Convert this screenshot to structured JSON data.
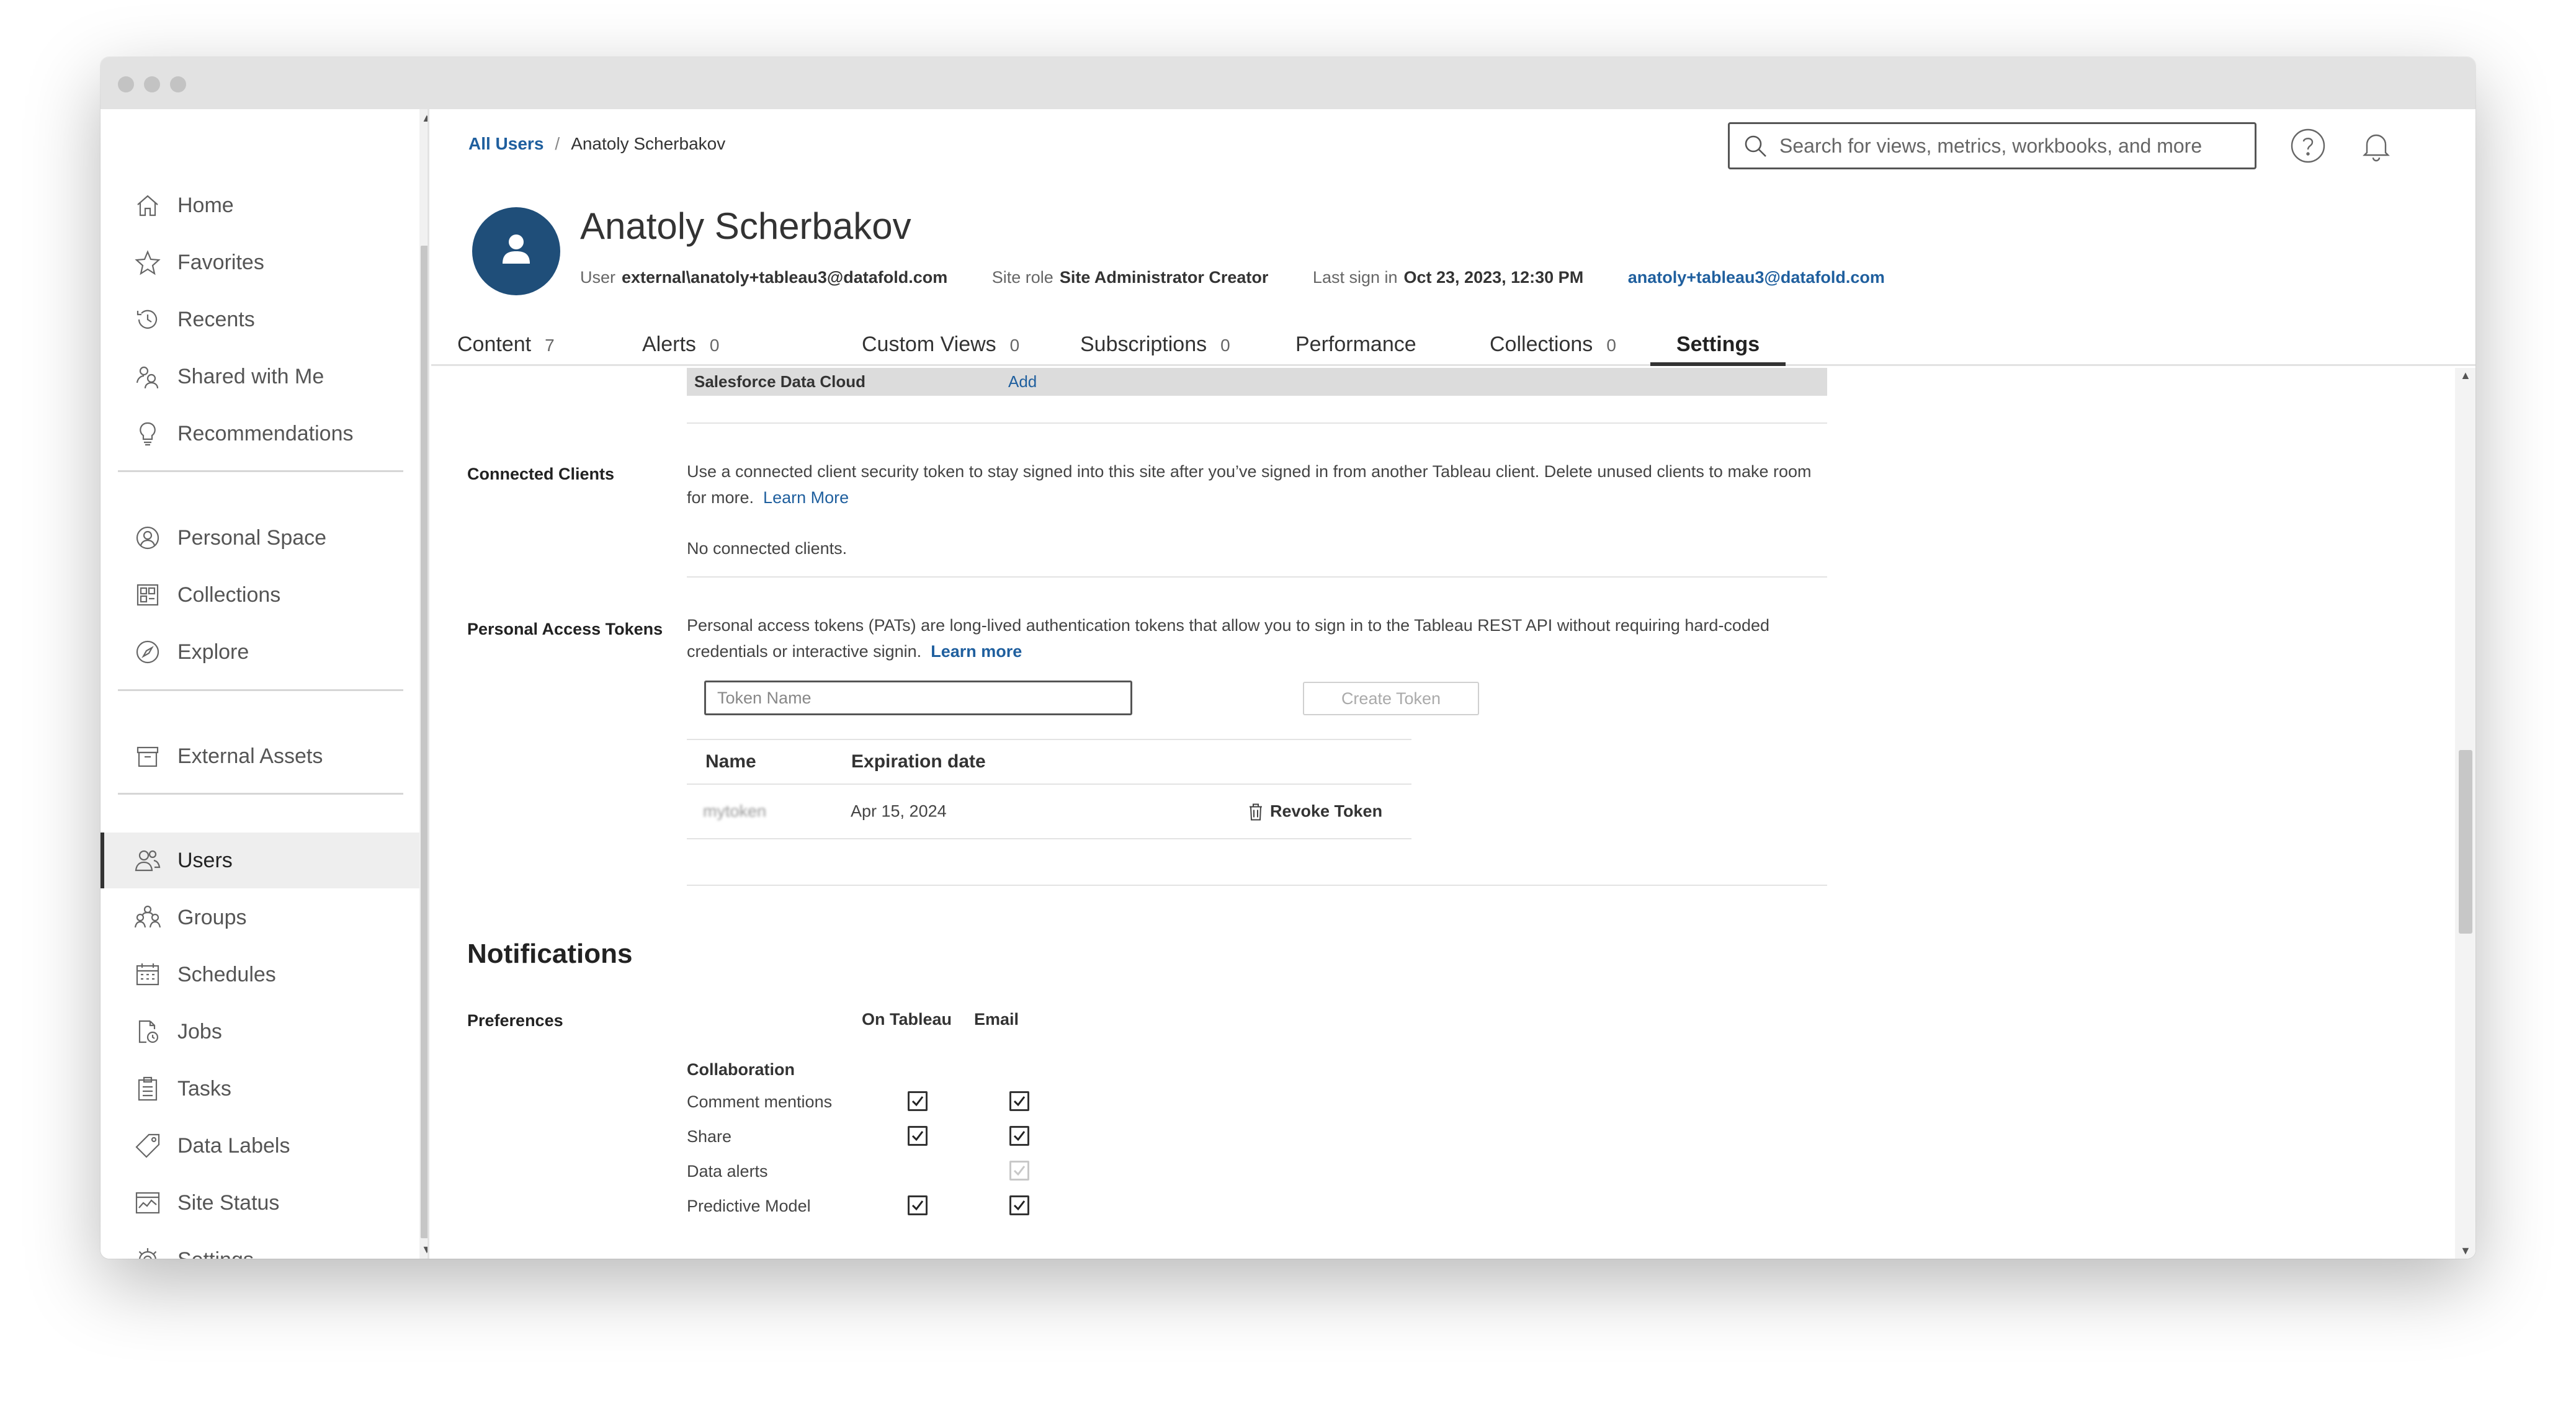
{
  "sidebar": {
    "items": [
      {
        "label": "Home",
        "icon": "home-icon"
      },
      {
        "label": "Favorites",
        "icon": "star-icon"
      },
      {
        "label": "Recents",
        "icon": "history-icon"
      },
      {
        "label": "Shared with Me",
        "icon": "shared-users-icon"
      },
      {
        "label": "Recommendations",
        "icon": "lightbulb-icon"
      },
      {
        "label": "Personal Space",
        "icon": "person-circle-icon"
      },
      {
        "label": "Collections",
        "icon": "collections-icon"
      },
      {
        "label": "Explore",
        "icon": "compass-icon"
      },
      {
        "label": "External Assets",
        "icon": "archive-icon"
      },
      {
        "label": "Users",
        "icon": "users-icon"
      },
      {
        "label": "Groups",
        "icon": "groups-icon"
      },
      {
        "label": "Schedules",
        "icon": "calendar-icon"
      },
      {
        "label": "Jobs",
        "icon": "job-icon"
      },
      {
        "label": "Tasks",
        "icon": "clipboard-icon"
      },
      {
        "label": "Data Labels",
        "icon": "tag-icon"
      },
      {
        "label": "Site Status",
        "icon": "site-status-icon"
      },
      {
        "label": "Settings",
        "icon": "gear-icon"
      }
    ],
    "active": "Users"
  },
  "header": {
    "breadcrumb_root": "All Users",
    "breadcrumb_sep": "/",
    "breadcrumb_current": "Anatoly Scherbakov",
    "search_placeholder": "Search for views, metrics, workbooks, and more"
  },
  "profile": {
    "name": "Anatoly Scherbakov",
    "user_label": "User",
    "user_value": "external\\anatoly+tableau3@datafold.com",
    "site_role_label": "Site role",
    "site_role_value": "Site Administrator Creator",
    "last_sign_in_label": "Last sign in",
    "last_sign_in_value": "Oct 23, 2023, 12:30 PM",
    "email": "anatoly+tableau3@datafold.com"
  },
  "tabs": [
    {
      "label": "Content",
      "count": "7"
    },
    {
      "label": "Alerts",
      "count": "0"
    },
    {
      "label": "Custom Views",
      "count": "0"
    },
    {
      "label": "Subscriptions",
      "count": "0"
    },
    {
      "label": "Performance",
      "count": ""
    },
    {
      "label": "Collections",
      "count": "0"
    },
    {
      "label": "Settings",
      "count": ""
    }
  ],
  "active_tab": "Settings",
  "settings": {
    "sf_row_label": "Salesforce Data Cloud",
    "sf_row_action": "Add",
    "connected_clients": {
      "label": "Connected Clients",
      "description": "Use a connected client security token to stay signed into this site after you’ve signed in from another Tableau client. Delete unused clients to make room for more.",
      "learn_more": "Learn More",
      "empty": "No connected clients."
    },
    "pat": {
      "label": "Personal Access Tokens",
      "description": "Personal access tokens (PATs) are long-lived authentication tokens that allow you to sign in to the Tableau REST API without requiring hard-coded credentials or interactive signin.",
      "learn_more": "Learn more",
      "token_name_placeholder": "Token Name",
      "create_button": "Create Token",
      "col_name": "Name",
      "col_expiration": "Expiration date",
      "rows": [
        {
          "name": "mytoken",
          "expiration": "Apr 15, 2024",
          "action": "Revoke Token"
        }
      ]
    }
  },
  "notifications": {
    "title": "Notifications",
    "preferences_label": "Preferences",
    "col_on_tableau": "On Tableau",
    "col_email": "Email",
    "group": "Collaboration",
    "rows": [
      {
        "label": "Comment mentions",
        "on_tableau": true,
        "email": true
      },
      {
        "label": "Share",
        "on_tableau": true,
        "email": true
      },
      {
        "label": "Data alerts",
        "on_tableau": null,
        "email": true,
        "email_disabled": true
      },
      {
        "label": "Predictive Model",
        "on_tableau": true,
        "email": true
      }
    ]
  },
  "colors": {
    "link": "#1f5f9e",
    "avatar": "#1f4e79",
    "active_tab_underline": "#333333"
  }
}
